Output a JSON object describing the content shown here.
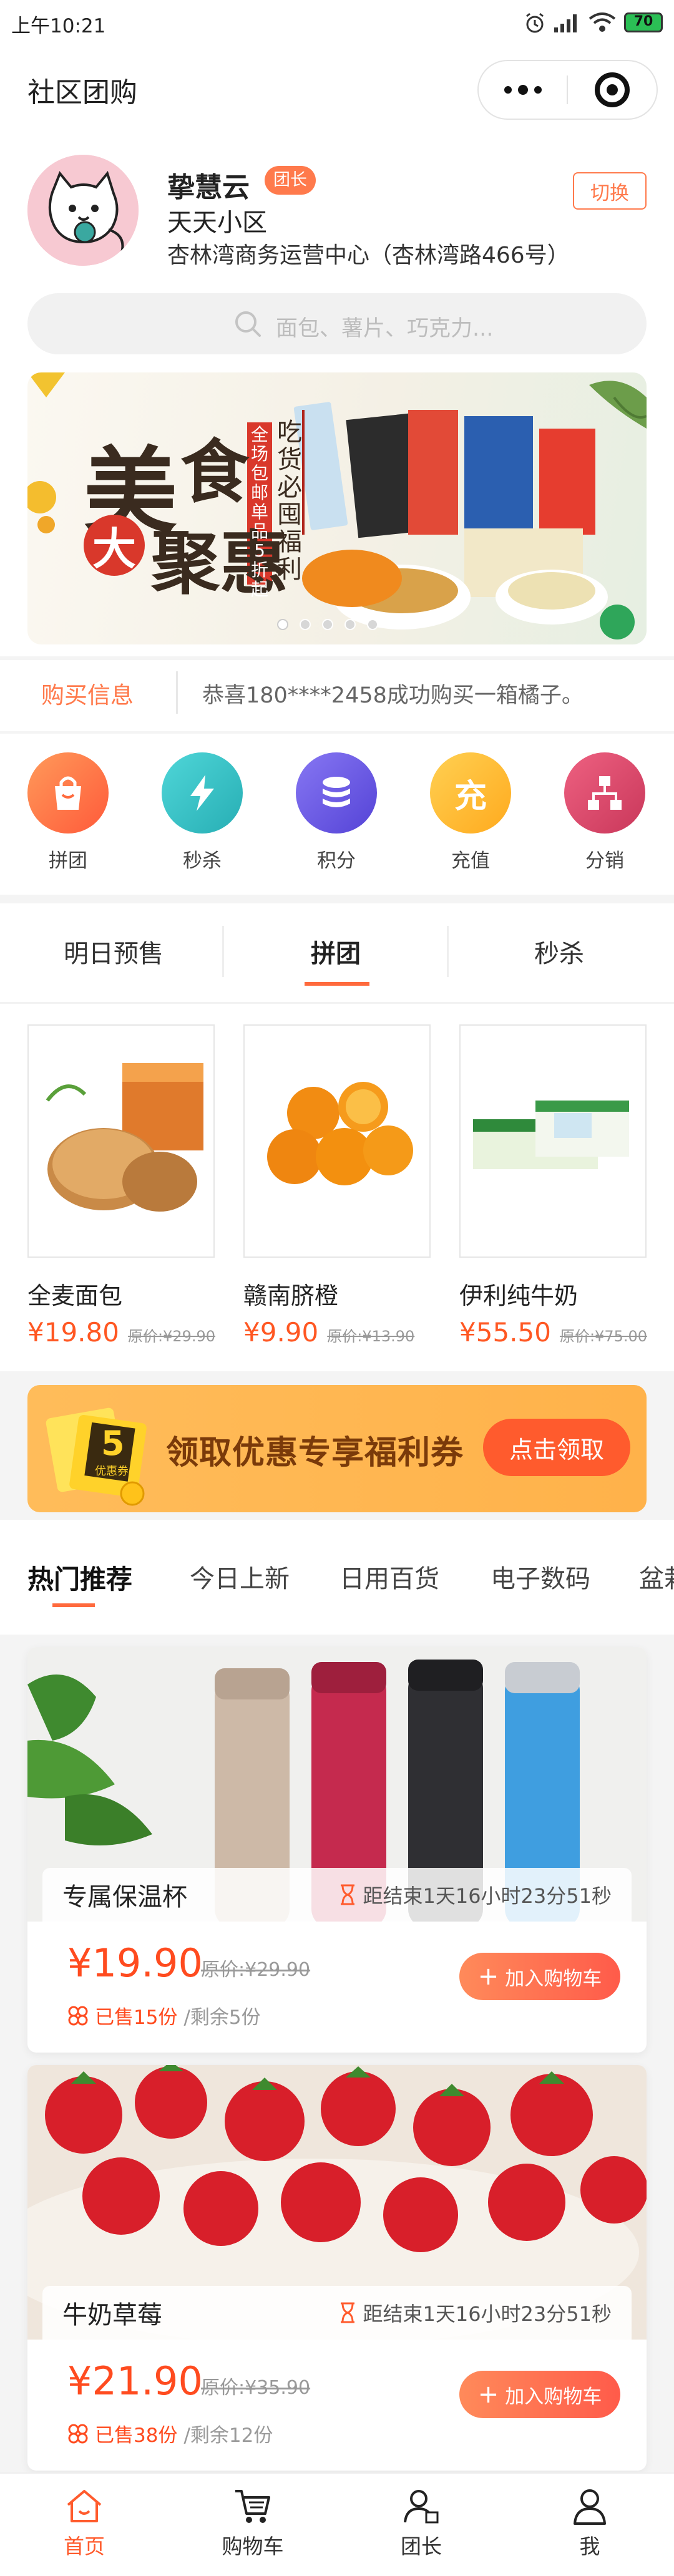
{
  "status_bar": {
    "time": "上午10:21",
    "battery": "70"
  },
  "nav": {
    "title": "社区团购"
  },
  "user": {
    "name": "挚慧云",
    "role_badge": "团长",
    "community": "天天小区",
    "address": "杏林湾商务运营中心（杏林湾路466号）",
    "switch_label": "切换"
  },
  "search": {
    "placeholder": "面包、薯片、巧克力..."
  },
  "banner": {
    "headline_1": "美",
    "headline_2": "食",
    "headline_3": "大",
    "headline_4": "聚惠",
    "vertical_red": "全场包邮 单品5折起",
    "vertical_black": "吃货必囤福利",
    "dots_count": 5,
    "active_dot": 0
  },
  "ticker": {
    "label": "购买信息",
    "message": "恭喜180****2458成功购买一箱橘子。"
  },
  "quick_nav": [
    {
      "label": "拼团",
      "icon": "bag-icon",
      "color": "#ff7043"
    },
    {
      "label": "秒杀",
      "icon": "lightning-icon",
      "color": "#39c6c9"
    },
    {
      "label": "积分",
      "icon": "coins-icon",
      "color": "#6a5ce8"
    },
    {
      "label": "充值",
      "icon": "recharge-icon",
      "glyph": "充",
      "color": "#ffb72a"
    },
    {
      "label": "分销",
      "icon": "distribution-icon",
      "color": "#e2476a"
    }
  ],
  "seg_tabs": {
    "tab1": "明日预售",
    "tab2": "拼团",
    "tab3": "秒杀",
    "active": 1
  },
  "group_products": [
    {
      "name": "全麦面包",
      "price": "¥19.80",
      "original": "原价:¥29.90",
      "image": "bread"
    },
    {
      "name": "赣南脐橙",
      "price": "¥9.90",
      "original": "原价:¥13.90",
      "image": "oranges"
    },
    {
      "name": "伊利纯牛奶",
      "price": "¥55.50",
      "original": "原价:¥75.00",
      "image": "milk"
    }
  ],
  "coupon": {
    "text": "领取优惠专享福利券",
    "button": "点击领取",
    "badge_value": "5",
    "badge_text": "优惠券"
  },
  "categories": {
    "c1": "热门推荐",
    "c2": "今日上新",
    "c3": "日用百货",
    "c4": "电子数码",
    "c5": "盆栽",
    "active": 0
  },
  "feed": [
    {
      "title": "专属保温杯",
      "countdown": "距结束1天16小时23分51秒",
      "price": "¥19.90",
      "original": "原价:¥29.90",
      "sold": "已售15份",
      "remaining": "/剩余5份",
      "add_label": "加入购物车",
      "image": "thermos"
    },
    {
      "title": "牛奶草莓",
      "countdown": "距结束1天16小时23分51秒",
      "price": "¥21.90",
      "original": "原价:¥35.90",
      "sold": "已售38份",
      "remaining": "/剩余12份",
      "add_label": "加入购物车",
      "image": "strawberries"
    }
  ],
  "tab_bar": {
    "home": "首页",
    "cart": "购物车",
    "leader": "团长",
    "me": "我",
    "active": "home"
  },
  "colors": {
    "accent": "#ff5b2d",
    "price": "#ff4b1f",
    "coupon_bg": "#ffb24a"
  }
}
